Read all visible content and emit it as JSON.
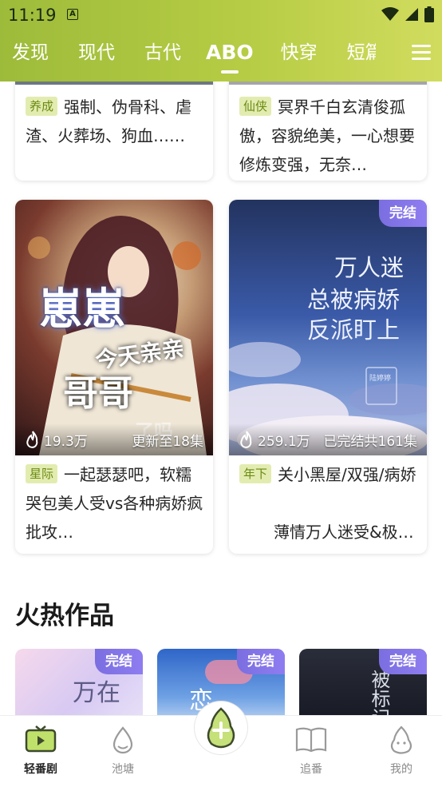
{
  "status_bar": {
    "time": "11:19",
    "sim_glyph": "A"
  },
  "tabs": [
    {
      "label": "发现",
      "active": false
    },
    {
      "label": "现代",
      "active": false
    },
    {
      "label": "古代",
      "active": false
    },
    {
      "label": "ABO",
      "active": true
    },
    {
      "label": "快穿",
      "active": false
    },
    {
      "label": "短篇",
      "active": false
    }
  ],
  "top_cards": [
    {
      "tag": "养成",
      "desc": "强制、伪骨科、虐渣、火葬场、狗血……"
    },
    {
      "tag": "仙侠",
      "desc": "冥界千白玄清俊孤傲，容貌绝美，一心想要修炼变强，无奈…"
    }
  ],
  "cards": [
    {
      "tag": "星际",
      "desc": "一起瑟瑟吧，软糯哭包美人受vs各种病娇疯批攻…",
      "heat": "19.3万",
      "episodes": "更新至18集",
      "badge": "",
      "cover_title_1": "崽崽",
      "cover_title_2": "今天亲亲",
      "cover_title_3": "哥哥",
      "cover_title_4": "了吗"
    },
    {
      "tag": "年下",
      "desc": "关小黑屋/双强/病娇",
      "desc_extra": "薄情万人迷受&极…",
      "heat": "259.1万",
      "episodes": "已完结共161集",
      "badge": "完结",
      "cover_title_1": "万人迷",
      "cover_title_2": "总被病娇",
      "cover_title_3": "反派盯上",
      "cover_seal": "陆婷婷"
    }
  ],
  "section": {
    "title": "火热作品"
  },
  "hot_items": [
    {
      "badge": "完结",
      "cover_text": "万在"
    },
    {
      "badge": "完结",
      "cover_text": "恋"
    },
    {
      "badge": "完结",
      "cover_text": "被标记"
    }
  ],
  "bottom_nav": [
    {
      "label": "轻番剧",
      "icon": "tv-icon",
      "active": true
    },
    {
      "label": "池塘",
      "icon": "pond-icon",
      "active": false
    },
    {
      "label": "",
      "icon": "add-pear-icon",
      "active": false
    },
    {
      "label": "追番",
      "icon": "book-icon",
      "active": false
    },
    {
      "label": "我的",
      "icon": "pear-face-icon",
      "active": false
    }
  ],
  "colors": {
    "header_start": "#9dbb3a",
    "header_end": "#d1dc5e",
    "tag_bg": "#e3ecb0",
    "tag_text": "#6a8a14",
    "badge": "#8e7df0"
  }
}
